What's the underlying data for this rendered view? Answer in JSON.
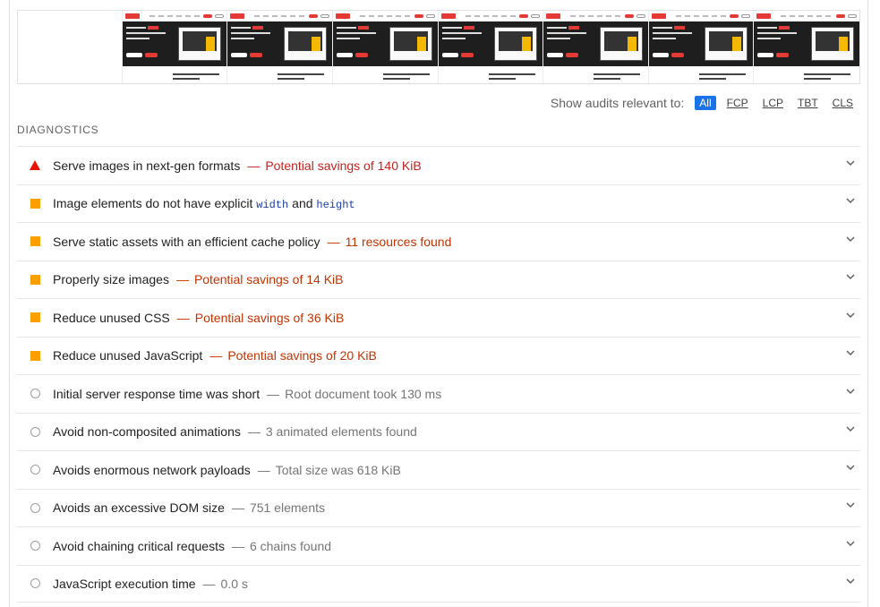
{
  "filmstrip": {
    "frame_count": 7
  },
  "filter": {
    "label": "Show audits relevant to:",
    "chips": [
      "All",
      "FCP",
      "LCP",
      "TBT",
      "CLS"
    ],
    "active": "All"
  },
  "section": {
    "title": "DIAGNOSTICS"
  },
  "colors": {
    "fail": "#eb0f00",
    "warn": "#fa9f00",
    "pass": "#9e9e9e",
    "accent": "#1a73e8"
  },
  "audits": [
    {
      "status": "fail",
      "title": "Serve images in next-gen formats",
      "separator": "—",
      "display": "Potential savings of 140 KiB"
    },
    {
      "status": "warn",
      "title_pre": "Image elements do not have explicit ",
      "code1": "width",
      "title_mid": " and ",
      "code2": "height"
    },
    {
      "status": "warn",
      "title": "Serve static assets with an efficient cache policy",
      "separator": "—",
      "display": "11 resources found"
    },
    {
      "status": "warn",
      "title": "Properly size images",
      "separator": "—",
      "display": "Potential savings of 14 KiB"
    },
    {
      "status": "warn",
      "title": "Reduce unused CSS",
      "separator": "—",
      "display": "Potential savings of 36 KiB"
    },
    {
      "status": "warn",
      "title": "Reduce unused JavaScript",
      "separator": "—",
      "display": "Potential savings of 20 KiB"
    },
    {
      "status": "pass",
      "title": "Initial server response time was short",
      "separator": "—",
      "display": "Root document took 130 ms"
    },
    {
      "status": "pass",
      "title": "Avoid non-composited animations",
      "separator": "—",
      "display": "3 animated elements found"
    },
    {
      "status": "pass",
      "title": "Avoids enormous network payloads",
      "separator": "—",
      "display": "Total size was 618 KiB"
    },
    {
      "status": "pass",
      "title": "Avoids an excessive DOM size",
      "separator": "—",
      "display": "751 elements"
    },
    {
      "status": "pass",
      "title": "Avoid chaining critical requests",
      "separator": "—",
      "display": "6 chains found"
    },
    {
      "status": "pass",
      "title": "JavaScript execution time",
      "separator": "—",
      "display": "0.0 s"
    }
  ]
}
